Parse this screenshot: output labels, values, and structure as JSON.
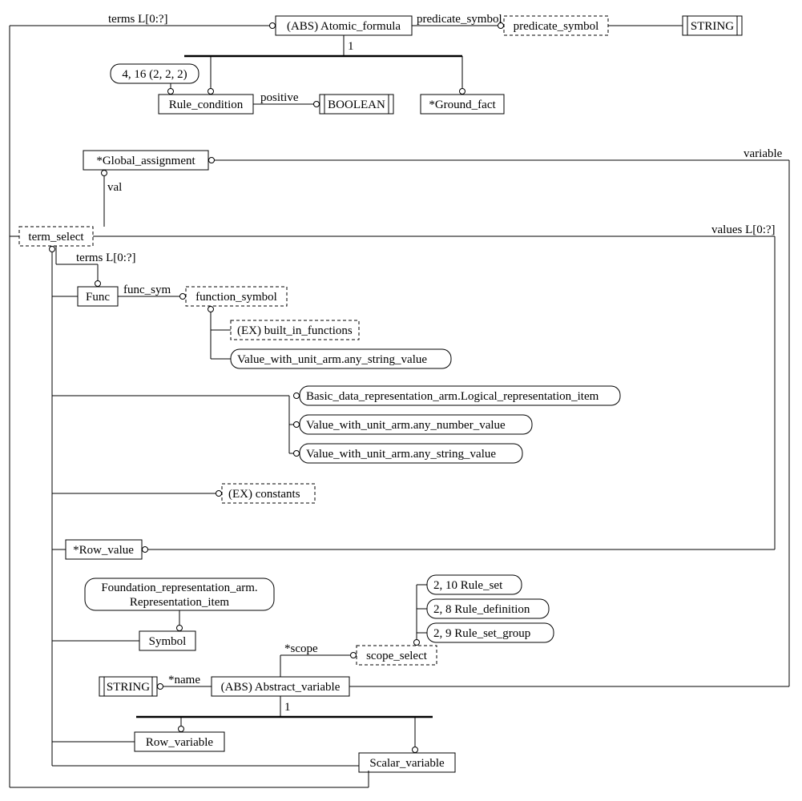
{
  "nodes": {
    "atomic_formula": "(ABS) Atomic_formula",
    "predicate_symbol": "predicate_symbol",
    "string_top": "STRING",
    "page_ref": "4, 16 (2, 2, 2)",
    "rule_condition": "Rule_condition",
    "boolean": "BOOLEAN",
    "ground_fact": "*Ground_fact",
    "global_assignment": "*Global_assignment",
    "term_select": "term_select",
    "func": "Func",
    "function_symbol": "function_symbol",
    "built_in_functions": "(EX) built_in_functions",
    "vwu_any_string1": "Value_with_unit_arm.any_string_value",
    "basic_logical": "Basic_data_representation_arm.Logical_representation_item",
    "vwu_any_number": "Value_with_unit_arm.any_number_value",
    "vwu_any_string2": "Value_with_unit_arm.any_string_value",
    "constants": "(EX) constants",
    "row_value": "*Row_value",
    "repr_item_l1": "Foundation_representation_arm.",
    "repr_item_l2": "Representation_item",
    "symbol": "Symbol",
    "rule_set": "2, 10 Rule_set",
    "rule_definition": "2, 8 Rule_definition",
    "rule_set_group": "2, 9 Rule_set_group",
    "scope_select": "scope_select",
    "string_name": "STRING",
    "abstract_variable": "(ABS) Abstract_variable",
    "row_variable": "Row_variable",
    "scalar_variable": "Scalar_variable"
  },
  "edges": {
    "terms_top": "terms L[0:?]",
    "predicate_sym_lbl": "predicate_symbol",
    "positive": "positive",
    "one1": "1",
    "variable": "variable",
    "val": "val",
    "values": "values L[0:?]",
    "terms_func": "terms L[0:?]",
    "func_sym": "func_sym",
    "scope": "*scope",
    "name": "*name",
    "one2": "1"
  }
}
